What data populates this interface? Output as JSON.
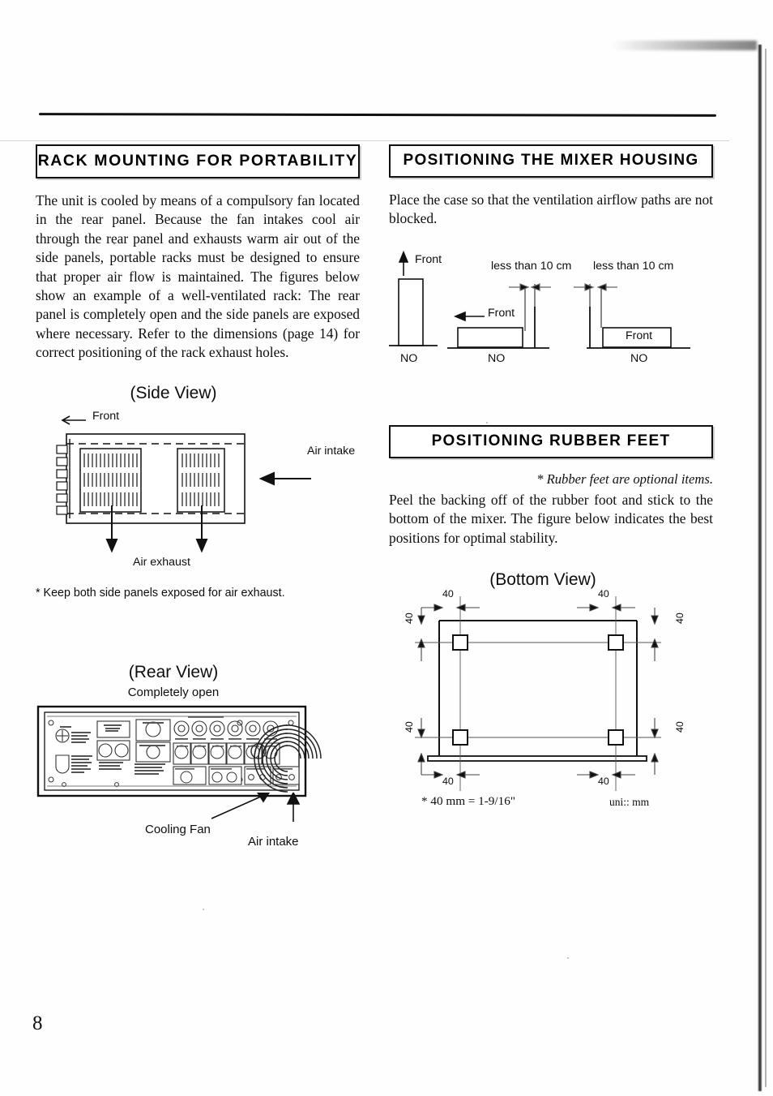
{
  "page": {
    "number": "8"
  },
  "left_column": {
    "section": {
      "heading": "RACK MOUNTING FOR PORTABILITY",
      "paragraph": "The unit is cooled by means of a compulsory fan located in the rear panel. Because the fan intakes cool air through the rear panel and exhausts warm air out of the side panels, portable racks must be designed to ensure that proper air flow is maintained. The figures below show an example of a well-ventilated rack: The rear panel is completely open and the side panels are exposed where necessary. Refer to the dimensions (page 14) for correct positioning of the rack exhaust holes."
    },
    "side_view": {
      "title": "(Side View)",
      "front_label": "Front",
      "air_intake_label": "Air intake",
      "air_exhaust_label": "Air exhaust",
      "footnote": "* Keep both side panels exposed for air exhaust."
    },
    "rear_view": {
      "title": "(Rear View)",
      "subtitle": "Completely open",
      "cooling_fan_label": "Cooling Fan",
      "air_intake_label": "Air intake"
    }
  },
  "right_column": {
    "housing_section": {
      "heading": "POSITIONING THE MIXER HOUSING",
      "paragraph": "Place the case so that the ventilation airflow paths are not blocked."
    },
    "housing_figure": {
      "cases": [
        {
          "orientation": "vertical",
          "front_label": "Front",
          "verdict": "NO",
          "clearance_label": ""
        },
        {
          "orientation": "horizontal-facing-left",
          "front_label": "Front",
          "verdict": "NO",
          "clearance_label": "less than 10 cm"
        },
        {
          "orientation": "horizontal-against-wall",
          "front_label": "Front",
          "verdict": "NO",
          "clearance_label": "less than 10 cm"
        }
      ]
    },
    "rubber_section": {
      "heading": "POSITIONING RUBBER FEET",
      "note": "* Rubber feet are optional items.",
      "paragraph": "Peel the backing off of the rubber foot and stick to the bottom of the mixer. The figure below indicates the best positions for optimal stability."
    },
    "bottom_view": {
      "title": "(Bottom View)",
      "dimensions": {
        "top_left": "40",
        "top_right": "40",
        "bottom_left": "40",
        "bottom_right": "40",
        "left_top": "40",
        "left_bottom": "40",
        "right_top": "40",
        "right_bottom": "40"
      },
      "conversion_note": "* 40 mm = 1-9/16\"",
      "unit_note": "uni:: mm"
    }
  }
}
